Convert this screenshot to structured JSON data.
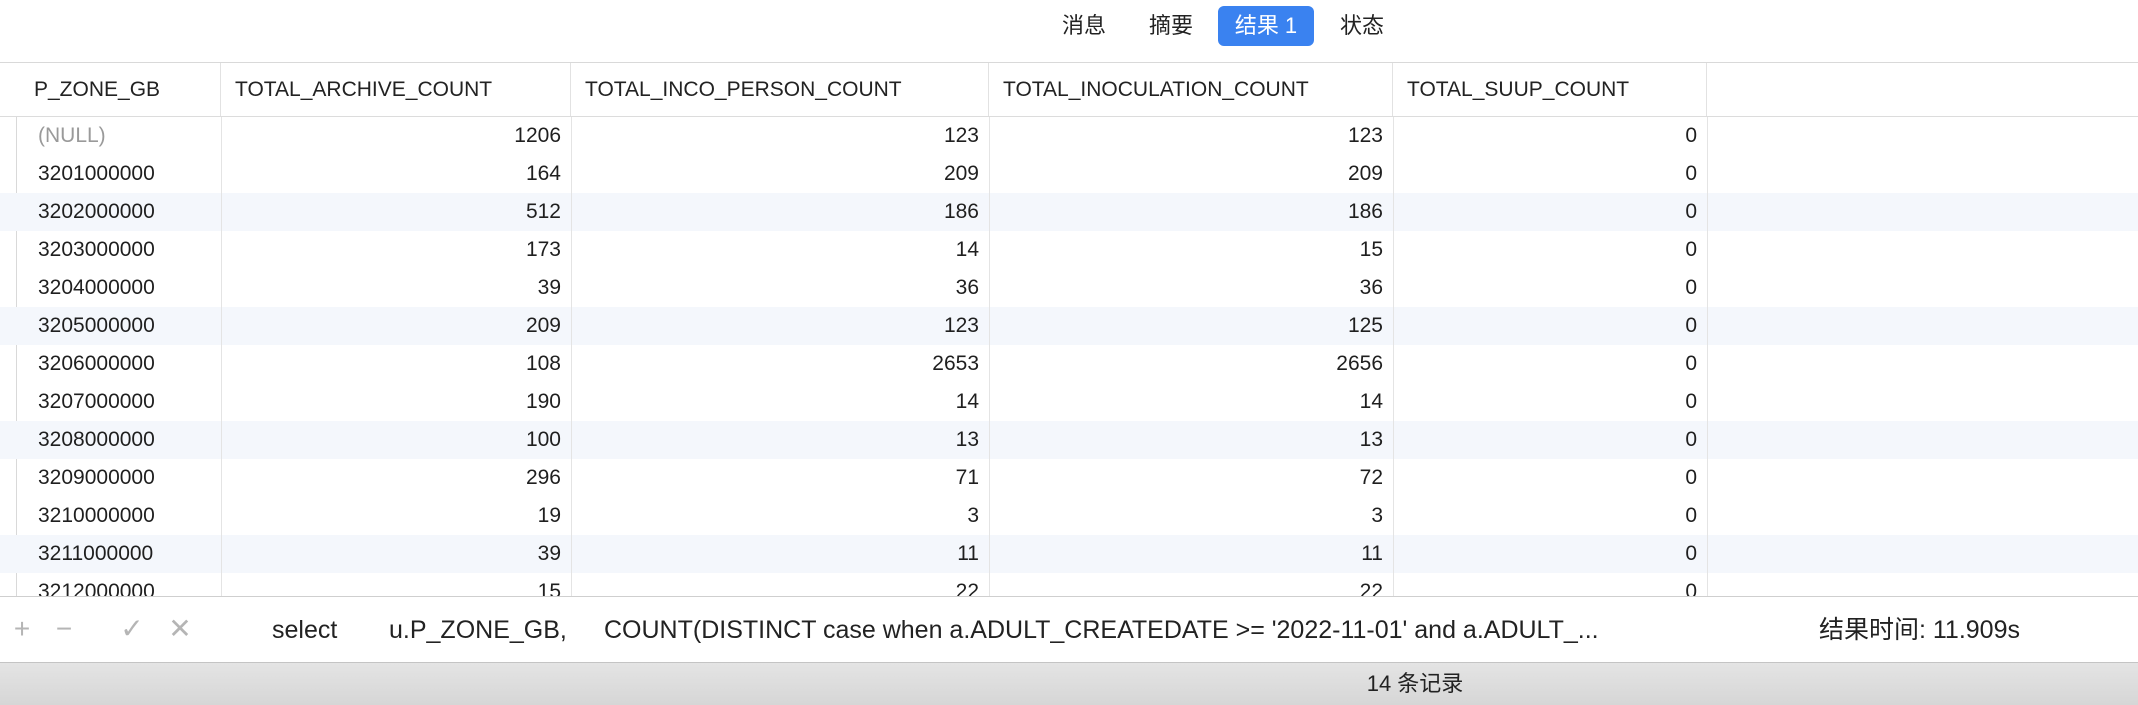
{
  "tabs": [
    {
      "label": "消息",
      "active": false
    },
    {
      "label": "摘要",
      "active": false
    },
    {
      "label": "结果 1",
      "active": true
    },
    {
      "label": "状态",
      "active": false
    }
  ],
  "columns": [
    "P_ZONE_GB",
    "TOTAL_ARCHIVE_COUNT",
    "TOTAL_INCO_PERSON_COUNT",
    "TOTAL_INOCULATION_COUNT",
    "TOTAL_SUUP_COUNT"
  ],
  "rows": [
    [
      "(NULL)",
      "1206",
      "123",
      "123",
      "0"
    ],
    [
      "3201000000",
      "164",
      "209",
      "209",
      "0"
    ],
    [
      "3202000000",
      "512",
      "186",
      "186",
      "0"
    ],
    [
      "3203000000",
      "173",
      "14",
      "15",
      "0"
    ],
    [
      "3204000000",
      "39",
      "36",
      "36",
      "0"
    ],
    [
      "3205000000",
      "209",
      "123",
      "125",
      "0"
    ],
    [
      "3206000000",
      "108",
      "2653",
      "2656",
      "0"
    ],
    [
      "3207000000",
      "190",
      "14",
      "14",
      "0"
    ],
    [
      "3208000000",
      "100",
      "13",
      "13",
      "0"
    ],
    [
      "3209000000",
      "296",
      "71",
      "72",
      "0"
    ],
    [
      "3210000000",
      "19",
      "3",
      "3",
      "0"
    ],
    [
      "3211000000",
      "39",
      "11",
      "11",
      "0"
    ],
    [
      "3212000000",
      "15",
      "22",
      "22",
      "0"
    ]
  ],
  "query_bar": {
    "add_icon": "+",
    "remove_icon": "−",
    "apply_icon": "✓",
    "discard_icon": "✕",
    "sql_part1": "select",
    "sql_part2": "u.P_ZONE_GB,",
    "sql_part3": "COUNT(DISTINCT case when a.ADULT_CREATEDATE >= '2022-11-01' and a.ADULT_...",
    "result_time": "结果时间: 11.909s"
  },
  "status": {
    "record_count": "14 条记录"
  }
}
